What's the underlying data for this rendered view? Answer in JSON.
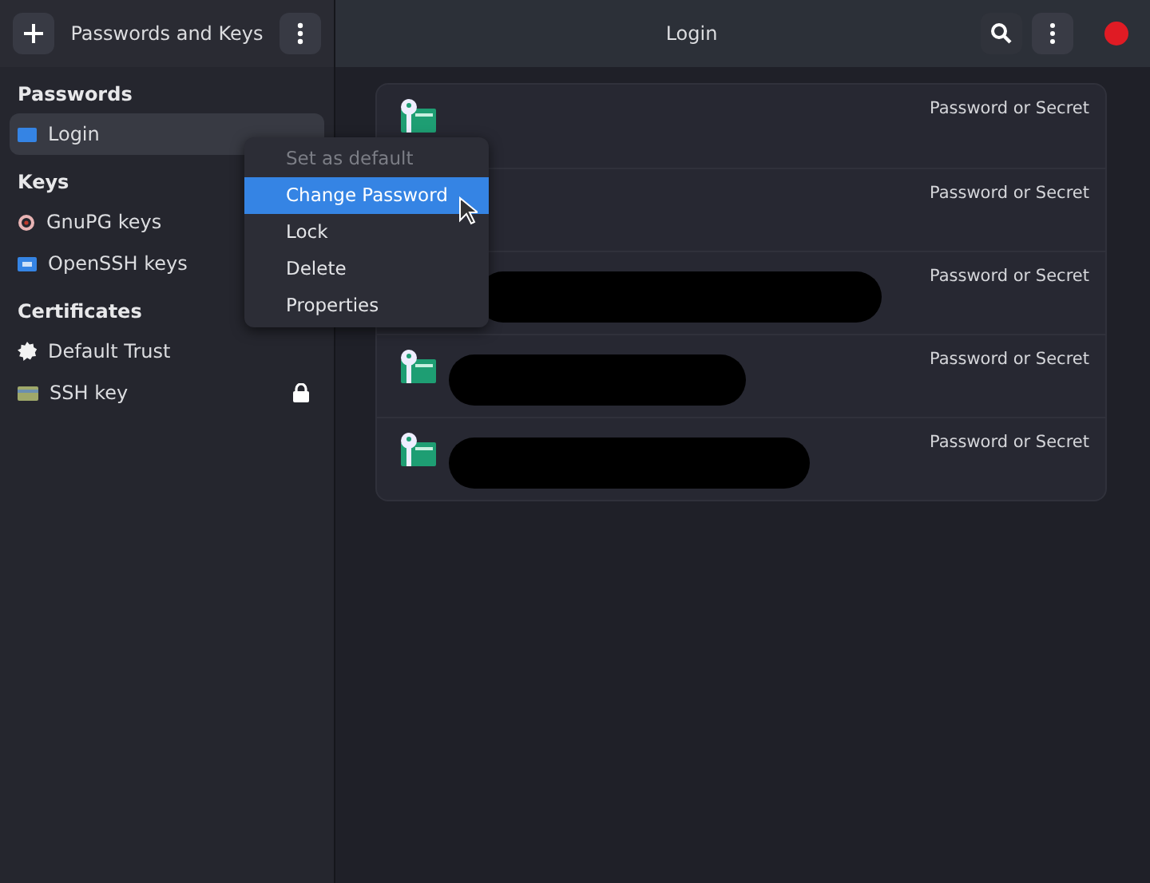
{
  "sidebar": {
    "title": "Passwords and Keys",
    "sections": [
      {
        "heading": "Passwords",
        "items": [
          {
            "label": "Login",
            "kind": "login",
            "selected": true,
            "locked": false
          }
        ]
      },
      {
        "heading": "Keys",
        "items": [
          {
            "label": "GnuPG keys",
            "kind": "gpg",
            "selected": false,
            "locked": false
          },
          {
            "label": "OpenSSH keys",
            "kind": "ssh",
            "selected": false,
            "locked": false
          }
        ]
      },
      {
        "heading": "Certificates",
        "items": [
          {
            "label": "Default Trust",
            "kind": "trust",
            "selected": false,
            "locked": false
          },
          {
            "label": "SSH key",
            "kind": "card",
            "selected": false,
            "locked": true
          }
        ]
      }
    ]
  },
  "content": {
    "title": "Login",
    "rows": [
      {
        "type": "Password or Secret",
        "icon": true,
        "redacted": false
      },
      {
        "type": "Password or Secret",
        "icon": false,
        "redacted": false
      },
      {
        "type": "Password or Secret",
        "icon": false,
        "redacted": true
      },
      {
        "type": "Password or Secret",
        "icon": true,
        "redacted": true
      },
      {
        "type": "Password or Secret",
        "icon": true,
        "redacted": true
      }
    ]
  },
  "context_menu": {
    "items": [
      {
        "label": "Set as default",
        "disabled": true,
        "selected": false
      },
      {
        "label": "Change Password",
        "disabled": false,
        "selected": true
      },
      {
        "label": "Lock",
        "disabled": false,
        "selected": false
      },
      {
        "label": "Delete",
        "disabled": false,
        "selected": false
      },
      {
        "label": "Properties",
        "disabled": false,
        "selected": false
      }
    ]
  }
}
